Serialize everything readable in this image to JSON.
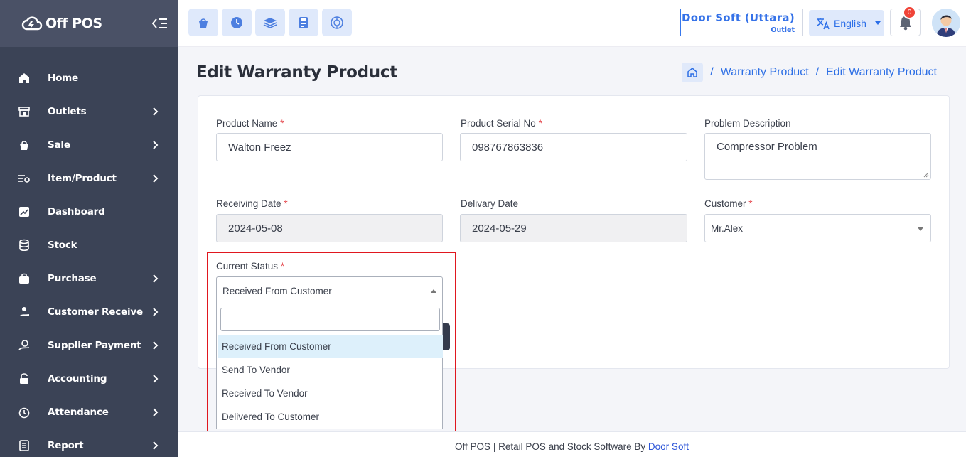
{
  "app": {
    "logo_text": "Off POS"
  },
  "sidebar": {
    "items": [
      {
        "label": "Home",
        "icon": "home-icon",
        "has_children": false
      },
      {
        "label": "Outlets",
        "icon": "store-icon",
        "has_children": true
      },
      {
        "label": "Sale",
        "icon": "basket-icon",
        "has_children": true
      },
      {
        "label": "Item/Product",
        "icon": "list-tag-icon",
        "has_children": true
      },
      {
        "label": "Dashboard",
        "icon": "chart-icon",
        "has_children": false
      },
      {
        "label": "Stock",
        "icon": "database-icon",
        "has_children": false
      },
      {
        "label": "Purchase",
        "icon": "bag-icon",
        "has_children": true
      },
      {
        "label": "Customer Receive",
        "icon": "hand-coin-icon",
        "has_children": true
      },
      {
        "label": "Supplier Payment",
        "icon": "payment-icon",
        "has_children": true
      },
      {
        "label": "Accounting",
        "icon": "lock-icon",
        "has_children": true
      },
      {
        "label": "Attendance",
        "icon": "clock-icon",
        "has_children": true
      },
      {
        "label": "Report",
        "icon": "report-icon",
        "has_children": true
      }
    ]
  },
  "topbar": {
    "quick_buttons": [
      "pos-icon",
      "clock-icon",
      "layers-icon",
      "calculator-icon",
      "globe-icon"
    ],
    "outlet_name": "Door Soft (Uttara)",
    "outlet_sub": "Outlet",
    "language": "English",
    "notification_count": "0"
  },
  "page": {
    "title": "Edit Warranty Product",
    "breadcrumb": [
      "Warranty Product",
      "Edit Warranty Product"
    ]
  },
  "form": {
    "product_name": {
      "label": "Product Name",
      "required": "*",
      "value": "Walton Freez"
    },
    "serial_no": {
      "label": "Product Serial No",
      "required": "*",
      "value": "098767863836"
    },
    "problem": {
      "label": "Problem Description",
      "value": "Compressor Problem"
    },
    "receiving_date": {
      "label": "Receiving Date",
      "required": "*",
      "value": "2024-05-08"
    },
    "delivery_date": {
      "label": "Delivary Date",
      "value": "2024-05-29"
    },
    "customer": {
      "label": "Customer",
      "required": "*",
      "value": "Mr.Alex"
    },
    "status": {
      "label": "Current Status",
      "required": "*",
      "value": "Received From Customer",
      "search_value": "",
      "options": [
        "Received From Customer",
        "Send To Vendor",
        "Received To Vendor",
        "Delivered To Customer"
      ]
    }
  },
  "footer": {
    "text": "Off POS | Retail POS and Stock Software By ",
    "brand": "Door Soft"
  },
  "colors": {
    "sidebar": "#3b4356",
    "accent": "#3572e8",
    "highlight": "#e0171f"
  }
}
